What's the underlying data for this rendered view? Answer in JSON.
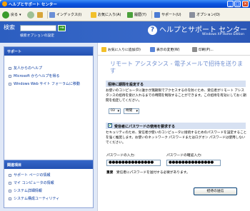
{
  "window": {
    "title": "ヘルプとサポート センター"
  },
  "toolbar": {
    "back_label": "戻る",
    "index_label": "インデックス(I)",
    "favorites_label": "お気に入り(A)",
    "history_label": "履歴(Y)",
    "support_label": "サポート(U)",
    "options_label": "オプション(O)"
  },
  "header": {
    "search_label": "検索",
    "search_value": "",
    "search_go": "→",
    "search_options": "検索オプションの設定",
    "title": "ヘルプとサポート センター",
    "subtitle": "Windows XP Home Edition"
  },
  "sidebar": {
    "support_heading": "サポート",
    "support_links": [
      "友人からのヘルプ",
      "Microsoft からヘルプを得る",
      "Windows Web サイト フォーラムに移動"
    ],
    "related_heading": "関連項目",
    "related_links": [
      "サポート ページの情報",
      "マイ コンピュータの情報",
      "システム詳細情報",
      "システム構成ユーティリティ"
    ]
  },
  "main": {
    "toolbar": {
      "add_favorites": "お気に入りに追加(D)",
      "change_view": "表示の変更(W)",
      "print": "印刷(P)..."
    },
    "page_title": "リモート アシスタンス - 電子メールで招待を送ります",
    "expiry": {
      "heading": "招待に期限を設定する",
      "text": "お使いのコンピュータに誰かが無期限でアクセスするのを防ぐため、受信者がリモート アシスタンスの招待を受け入れるまでの時間を制限することができます。この招待を有効にしておく期間を指定してください。",
      "amount": "03",
      "unit": "時間"
    },
    "password": {
      "heading": "受信者にパスワードの使用を要求する",
      "checked": true,
      "text": "セキュリティのため、受信者が使いのコンピュータに接続するためのパスワードを設定することを強く推奨します。お使いのネットワーク パスワードまたはログオン パスワードは使用しないでください。",
      "input_label": "パスワードの入力:",
      "confirm_label": "パスワードの確認入力:",
      "input_value": "●●●●●●●●●●●●●●",
      "confirm_value": "●●●●●●●●●●●●●●",
      "important_label": "重要",
      "important_text": "受信者にパスワードを送付する必要があります。"
    },
    "send_button": "招待の送信"
  },
  "colors": {
    "title_blue": "#0a54e0",
    "header_blue": "#2c5ec0",
    "link_blue": "#00349c",
    "section_bg": "#d7e1f2"
  }
}
